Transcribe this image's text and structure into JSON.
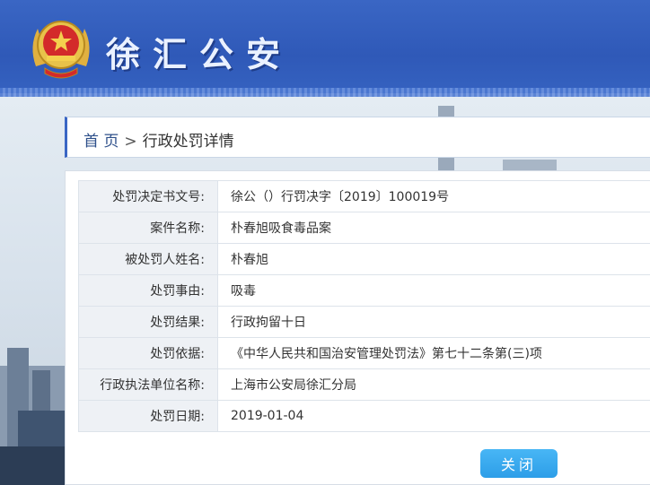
{
  "header": {
    "brand_title": "徐汇公安",
    "colors": {
      "primary": "#3a66c4",
      "button": "#2d9ee8"
    }
  },
  "breadcrumb": {
    "home": "首 页",
    "separator": ">",
    "current": "行政处罚详情"
  },
  "detail": {
    "rows": [
      {
        "label": "处罚决定书文号:",
        "value": "徐公（）行罚决字〔2019〕100019号"
      },
      {
        "label": "案件名称:",
        "value": "朴春旭吸食毒品案"
      },
      {
        "label": "被处罚人姓名:",
        "value": "朴春旭"
      },
      {
        "label": "处罚事由:",
        "value": "吸毒"
      },
      {
        "label": "处罚结果:",
        "value": "行政拘留十日"
      },
      {
        "label": "处罚依据:",
        "value": "《中华人民共和国治安管理处罚法》第七十二条第(三)项"
      },
      {
        "label": "行政执法单位名称:",
        "value": "上海市公安局徐汇分局"
      },
      {
        "label": "处罚日期:",
        "value": "2019-01-04"
      }
    ]
  },
  "actions": {
    "close_label": "关闭"
  }
}
